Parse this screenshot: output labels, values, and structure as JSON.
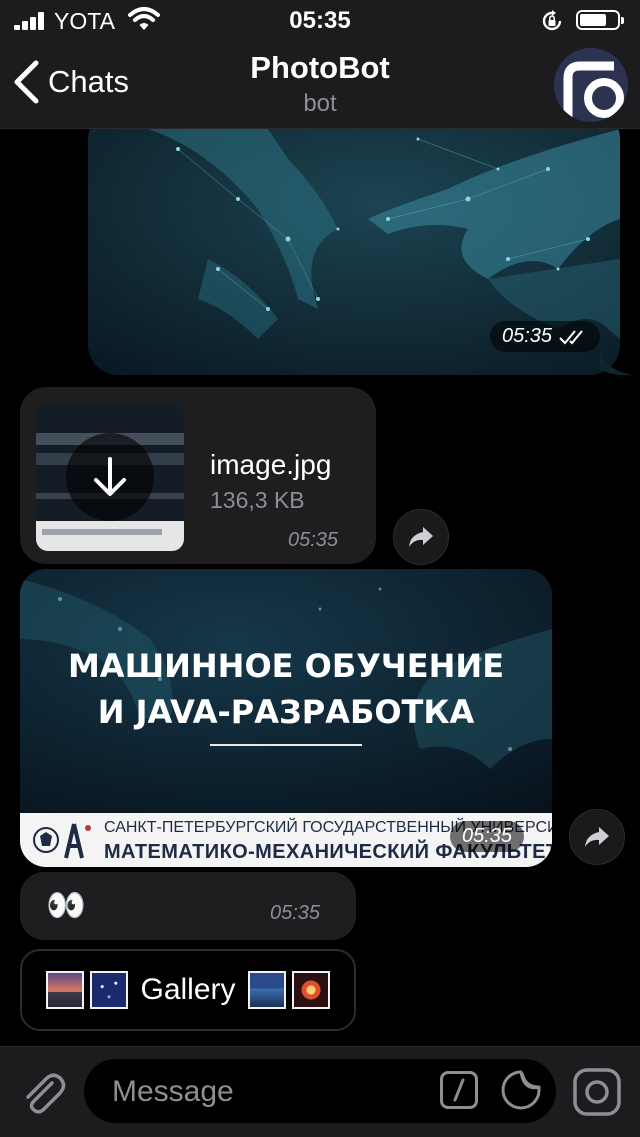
{
  "status_bar": {
    "carrier": "YOTA",
    "time": "05:35"
  },
  "header": {
    "back_label": "Chats",
    "title": "PhotoBot",
    "subtitle": "bot"
  },
  "messages": {
    "outgoing_photo": {
      "time": "05:35"
    },
    "file": {
      "name": "image.jpg",
      "size": "136,3 KB",
      "time": "05:35"
    },
    "banner_photo": {
      "line1": "МАШИННОЕ ОБУЧЕНИЕ",
      "line2": "И JAVA-РАЗРАБОТКА",
      "footer_line1": "САНКТ-ПЕТЕРБУРГСКИЙ ГОСУДАРСТВЕННЫЙ УНИВЕРСИТЕТ",
      "footer_line2": "МАТЕМАТИКО-МЕХАНИЧЕСКИЙ ФАКУЛЬТЕТ",
      "time": "05:35"
    },
    "emoji_message": {
      "text": "👀",
      "time": "05:35"
    }
  },
  "keyboard_button": {
    "label": "Gallery"
  },
  "input": {
    "placeholder": "Message"
  },
  "icons": [
    "signal-icon",
    "wifi-icon",
    "rotation-lock-icon",
    "battery-icon",
    "back-chevron-icon",
    "camera-logo-icon",
    "double-check-icon",
    "download-arrow-icon",
    "share-forward-icon",
    "paperclip-icon",
    "slash-command-icon",
    "sticker-icon",
    "camera-icon"
  ],
  "colors": {
    "bar_bg": "#1c1c1e",
    "bubble_bg": "#1e1e20",
    "secondary_text": "#8e8e93"
  }
}
